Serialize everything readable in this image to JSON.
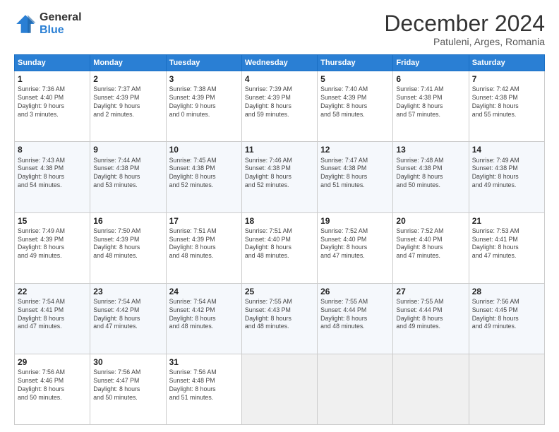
{
  "header": {
    "logo_line1": "General",
    "logo_line2": "Blue",
    "month": "December 2024",
    "location": "Patuleni, Arges, Romania"
  },
  "days_of_week": [
    "Sunday",
    "Monday",
    "Tuesday",
    "Wednesday",
    "Thursday",
    "Friday",
    "Saturday"
  ],
  "weeks": [
    [
      {
        "day": 1,
        "info": "Sunrise: 7:36 AM\nSunset: 4:40 PM\nDaylight: 9 hours\nand 3 minutes."
      },
      {
        "day": 2,
        "info": "Sunrise: 7:37 AM\nSunset: 4:39 PM\nDaylight: 9 hours\nand 2 minutes."
      },
      {
        "day": 3,
        "info": "Sunrise: 7:38 AM\nSunset: 4:39 PM\nDaylight: 9 hours\nand 0 minutes."
      },
      {
        "day": 4,
        "info": "Sunrise: 7:39 AM\nSunset: 4:39 PM\nDaylight: 8 hours\nand 59 minutes."
      },
      {
        "day": 5,
        "info": "Sunrise: 7:40 AM\nSunset: 4:39 PM\nDaylight: 8 hours\nand 58 minutes."
      },
      {
        "day": 6,
        "info": "Sunrise: 7:41 AM\nSunset: 4:38 PM\nDaylight: 8 hours\nand 57 minutes."
      },
      {
        "day": 7,
        "info": "Sunrise: 7:42 AM\nSunset: 4:38 PM\nDaylight: 8 hours\nand 55 minutes."
      }
    ],
    [
      {
        "day": 8,
        "info": "Sunrise: 7:43 AM\nSunset: 4:38 PM\nDaylight: 8 hours\nand 54 minutes."
      },
      {
        "day": 9,
        "info": "Sunrise: 7:44 AM\nSunset: 4:38 PM\nDaylight: 8 hours\nand 53 minutes."
      },
      {
        "day": 10,
        "info": "Sunrise: 7:45 AM\nSunset: 4:38 PM\nDaylight: 8 hours\nand 52 minutes."
      },
      {
        "day": 11,
        "info": "Sunrise: 7:46 AM\nSunset: 4:38 PM\nDaylight: 8 hours\nand 52 minutes."
      },
      {
        "day": 12,
        "info": "Sunrise: 7:47 AM\nSunset: 4:38 PM\nDaylight: 8 hours\nand 51 minutes."
      },
      {
        "day": 13,
        "info": "Sunrise: 7:48 AM\nSunset: 4:38 PM\nDaylight: 8 hours\nand 50 minutes."
      },
      {
        "day": 14,
        "info": "Sunrise: 7:49 AM\nSunset: 4:38 PM\nDaylight: 8 hours\nand 49 minutes."
      }
    ],
    [
      {
        "day": 15,
        "info": "Sunrise: 7:49 AM\nSunset: 4:39 PM\nDaylight: 8 hours\nand 49 minutes."
      },
      {
        "day": 16,
        "info": "Sunrise: 7:50 AM\nSunset: 4:39 PM\nDaylight: 8 hours\nand 48 minutes."
      },
      {
        "day": 17,
        "info": "Sunrise: 7:51 AM\nSunset: 4:39 PM\nDaylight: 8 hours\nand 48 minutes."
      },
      {
        "day": 18,
        "info": "Sunrise: 7:51 AM\nSunset: 4:40 PM\nDaylight: 8 hours\nand 48 minutes."
      },
      {
        "day": 19,
        "info": "Sunrise: 7:52 AM\nSunset: 4:40 PM\nDaylight: 8 hours\nand 47 minutes."
      },
      {
        "day": 20,
        "info": "Sunrise: 7:52 AM\nSunset: 4:40 PM\nDaylight: 8 hours\nand 47 minutes."
      },
      {
        "day": 21,
        "info": "Sunrise: 7:53 AM\nSunset: 4:41 PM\nDaylight: 8 hours\nand 47 minutes."
      }
    ],
    [
      {
        "day": 22,
        "info": "Sunrise: 7:54 AM\nSunset: 4:41 PM\nDaylight: 8 hours\nand 47 minutes."
      },
      {
        "day": 23,
        "info": "Sunrise: 7:54 AM\nSunset: 4:42 PM\nDaylight: 8 hours\nand 47 minutes."
      },
      {
        "day": 24,
        "info": "Sunrise: 7:54 AM\nSunset: 4:42 PM\nDaylight: 8 hours\nand 48 minutes."
      },
      {
        "day": 25,
        "info": "Sunrise: 7:55 AM\nSunset: 4:43 PM\nDaylight: 8 hours\nand 48 minutes."
      },
      {
        "day": 26,
        "info": "Sunrise: 7:55 AM\nSunset: 4:44 PM\nDaylight: 8 hours\nand 48 minutes."
      },
      {
        "day": 27,
        "info": "Sunrise: 7:55 AM\nSunset: 4:44 PM\nDaylight: 8 hours\nand 49 minutes."
      },
      {
        "day": 28,
        "info": "Sunrise: 7:56 AM\nSunset: 4:45 PM\nDaylight: 8 hours\nand 49 minutes."
      }
    ],
    [
      {
        "day": 29,
        "info": "Sunrise: 7:56 AM\nSunset: 4:46 PM\nDaylight: 8 hours\nand 50 minutes."
      },
      {
        "day": 30,
        "info": "Sunrise: 7:56 AM\nSunset: 4:47 PM\nDaylight: 8 hours\nand 50 minutes."
      },
      {
        "day": 31,
        "info": "Sunrise: 7:56 AM\nSunset: 4:48 PM\nDaylight: 8 hours\nand 51 minutes."
      },
      null,
      null,
      null,
      null
    ]
  ]
}
